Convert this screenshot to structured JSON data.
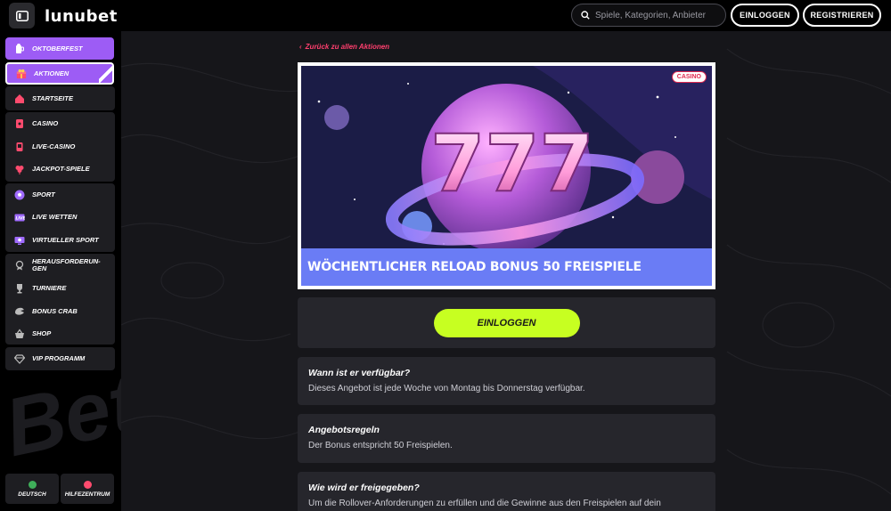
{
  "header": {
    "logo": "lunubet",
    "search_placeholder": "Spiele, Kategorien, Anbieter",
    "login_label": "EINLOGGEN",
    "register_label": "REGISTRIEREN"
  },
  "sidebar": {
    "items": [
      {
        "label": "OKTOBERFEST",
        "icon": "beer-icon"
      },
      {
        "label": "AKTIONEN",
        "icon": "gift-icon"
      },
      {
        "label": "STARTSEITE",
        "icon": "home-icon"
      },
      {
        "label": "CASINO",
        "icon": "cards-icon"
      },
      {
        "label": "LIVE-CASINO",
        "icon": "live-casino-icon"
      },
      {
        "label": "JACKPOT-SPIELE",
        "icon": "clover-icon"
      },
      {
        "label": "SPORT",
        "icon": "soccer-ball-icon"
      },
      {
        "label": "LIVE WETTEN",
        "icon": "live-bet-icon"
      },
      {
        "label": "VIRTUELLER SPORT",
        "icon": "virtual-sport-icon"
      },
      {
        "label": "HERAUSFORDERUN-GEN",
        "icon": "medal-icon"
      },
      {
        "label": "TURNIERE",
        "icon": "trophy-icon"
      },
      {
        "label": "BONUS CRAB",
        "icon": "crab-icon"
      },
      {
        "label": "SHOP",
        "icon": "basket-icon"
      },
      {
        "label": "VIP PROGRAMM",
        "icon": "diamond-icon"
      }
    ],
    "footer": {
      "language": "DEUTSCH",
      "help": "HILFEZENTRUM"
    }
  },
  "main": {
    "back_link": "Zurück zu allen Aktionen",
    "banner": {
      "tag": "CASINO",
      "caption": "WÖCHENTLICHER RELOAD BONUS 50 FREISPIELE",
      "number": "777"
    },
    "login_button": "EINLOGGEN",
    "sections": [
      {
        "title": "Wann ist er verfügbar?",
        "text": "Dieses Angebot ist jede Woche von Montag bis Donnerstag verfügbar."
      },
      {
        "title": "Angebotsregeln",
        "text": "Der Bonus entspricht 50 Freispielen."
      },
      {
        "title": "Wie wird er freigegeben?",
        "text": "Um die Rollover-Anforderungen zu erfüllen und die Gewinne aus den Freispielen auf dein"
      }
    ]
  },
  "colors": {
    "accent_purple": "#9d5cf5",
    "accent_lime": "#c7ff21",
    "link_pink": "#ff3f6e",
    "banner_caption": "#6a7cf5"
  }
}
